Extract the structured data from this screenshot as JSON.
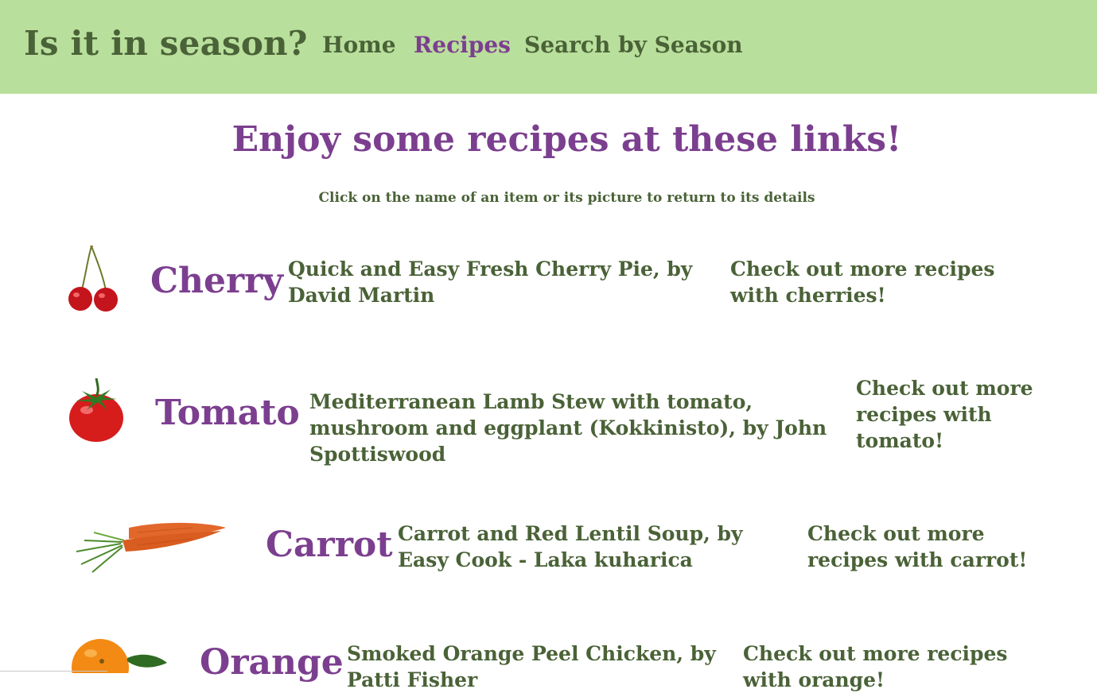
{
  "header": {
    "brand": "Is it in season?",
    "nav": [
      {
        "label": "Home"
      },
      {
        "label": "Recipes"
      },
      {
        "label": "Search by Season"
      }
    ]
  },
  "main": {
    "title": "Enjoy some recipes at these links!",
    "subtitle": "Click on the name of an item or its picture to return to its details",
    "items": [
      {
        "name": "Cherry",
        "recipe": "Quick and Easy Fresh Cherry Pie, by David Martin",
        "more": "Check out more recipes with cherries!",
        "image_icon": "cherry-image"
      },
      {
        "name": "Tomato",
        "recipe": "Mediterranean Lamb Stew with tomato, mushroom and eggplant (Kokkinisto), by John Spottiswood",
        "more": "Check out more recipes with tomato!",
        "image_icon": "tomato-image"
      },
      {
        "name": "Carrot",
        "recipe": "Carrot and Red Lentil Soup, by Easy Cook - Laka kuharica",
        "more": "Check out more recipes with carrot!",
        "image_icon": "carrot-image"
      },
      {
        "name": "Orange",
        "recipe": "Smoked Orange Peel Chicken, by Patti Fisher",
        "more": "Check out more recipes with orange!",
        "image_icon": "orange-image"
      }
    ]
  },
  "colors": {
    "header_bg": "#b9df9c",
    "text_green": "#4a6237",
    "accent_purple": "#7c3f8f"
  }
}
